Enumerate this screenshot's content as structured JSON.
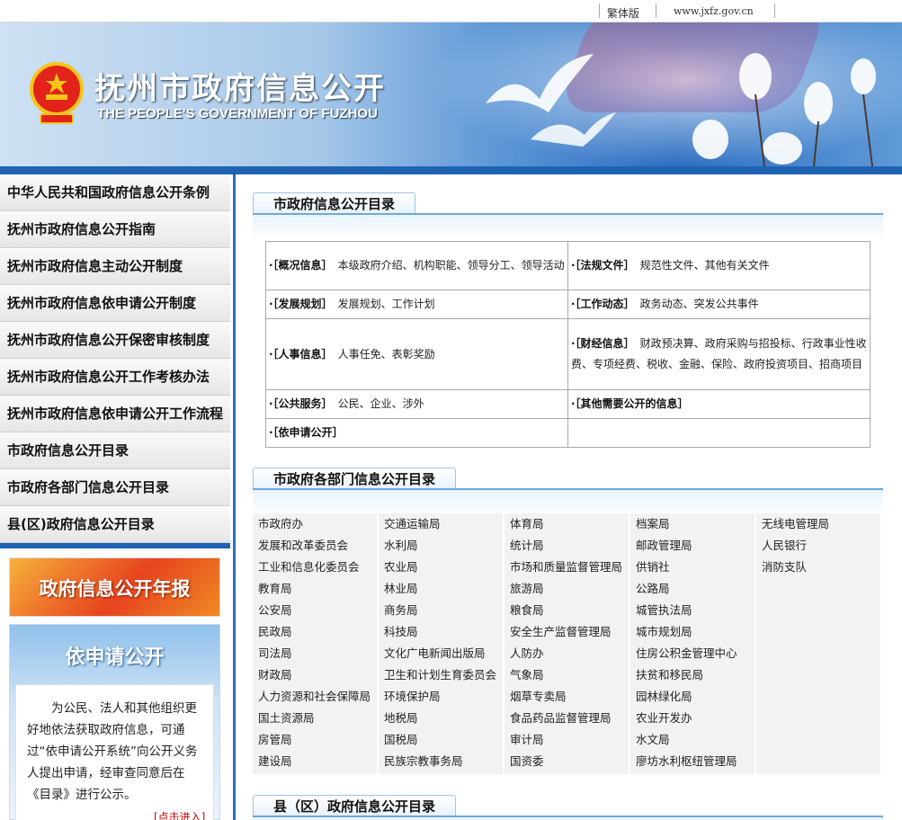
{
  "topbar": {
    "traditional": "繁体版",
    "domain": "www.jxfz.gov.cn"
  },
  "banner": {
    "title_cn": "抚州市政府信息公开",
    "title_en": "THE PEOPLE'S GOVERNMENT OF FUZHOU"
  },
  "colors": {
    "accent": "#1f63b3",
    "promo_red": "#e7431f"
  },
  "nav": [
    "中华人民共和国政府信息公开条例",
    "抚州市政府信息公开指南",
    "抚州市政府信息主动公开制度",
    "抚州市政府信息依申请公开制度",
    "抚州市政府信息公开保密审核制度",
    "抚州市政府信息公开工作考核办法",
    "抚州市政府信息依申请公开工作流程",
    "市政府信息公开目录",
    "市政府各部门信息公开目录",
    "县(区)政府信息公开目录"
  ],
  "promo_report": "政府信息公开年报",
  "promo_apply": {
    "title": "依申请公开",
    "text": "为公民、法人和其他组织更好地依法获取政府信息，可通过“依申请公开系统”向公开义务人提出申请，经审查同意后在《目录》进行公示。",
    "more": "[点击进入]"
  },
  "sections": {
    "catalog": "市政府信息公开目录",
    "departments": "市政府各部门信息公开目录",
    "counties": "县（区）政府信息公开目录"
  },
  "catalog_rows": [
    [
      {
        "k": "·［概况信息］",
        "v": "本级政府介绍、机构职能、领导分工、领导活动"
      },
      {
        "k": "·［法规文件］",
        "v": "规范性文件、其他有关文件"
      }
    ],
    [
      {
        "k": "·［发展规划］",
        "v": "发展规划、工作计划"
      },
      {
        "k": "·［工作动态］",
        "v": "政务动态、突发公共事件"
      }
    ],
    [
      {
        "k": "·［人事信息］",
        "v": "人事任免、表彰奖励"
      },
      {
        "k": "·［财经信息］",
        "v": "财政预决算、政府采购与招投标、行政事业性收费、专项经费、税收、金融、保险、政府投资项目、招商项目"
      }
    ],
    [
      {
        "k": "·［公共服务］",
        "v": "公民、企业、涉外"
      },
      {
        "k": "·［其他需要公开的信息］",
        "v": ""
      }
    ],
    [
      {
        "k": "·［依申请公开］",
        "v": ""
      },
      {
        "k": "",
        "v": ""
      }
    ]
  ],
  "departments": [
    [
      "市政府办",
      "发展和改革委员会",
      "工业和信息化委员会",
      "教育局",
      "公安局",
      "民政局",
      "司法局",
      "财政局",
      "人力资源和社会保障局",
      "国土资源局",
      "房管局",
      "建设局"
    ],
    [
      "交通运输局",
      "水利局",
      "农业局",
      "林业局",
      "商务局",
      "科技局",
      "文化广电新闻出版局",
      "卫生和计划生育委员会",
      "环境保护局",
      "地税局",
      "国税局",
      "民族宗教事务局"
    ],
    [
      "体育局",
      "统计局",
      "市场和质量监督管理局",
      "旅游局",
      "粮食局",
      "安全生产监督管理局",
      "人防办",
      "气象局",
      "烟草专卖局",
      "食品药品监督管理局",
      "审计局",
      "国资委"
    ],
    [
      "档案局",
      "邮政管理局",
      "供销社",
      "公路局",
      "城管执法局",
      "城市规划局",
      "住房公积金管理中心",
      "扶贫和移民局",
      "园林绿化局",
      "农业开发办",
      "水文局",
      "廖坊水利枢纽管理局"
    ],
    [
      "无线电管理局",
      "人民银行",
      "消防支队"
    ]
  ]
}
